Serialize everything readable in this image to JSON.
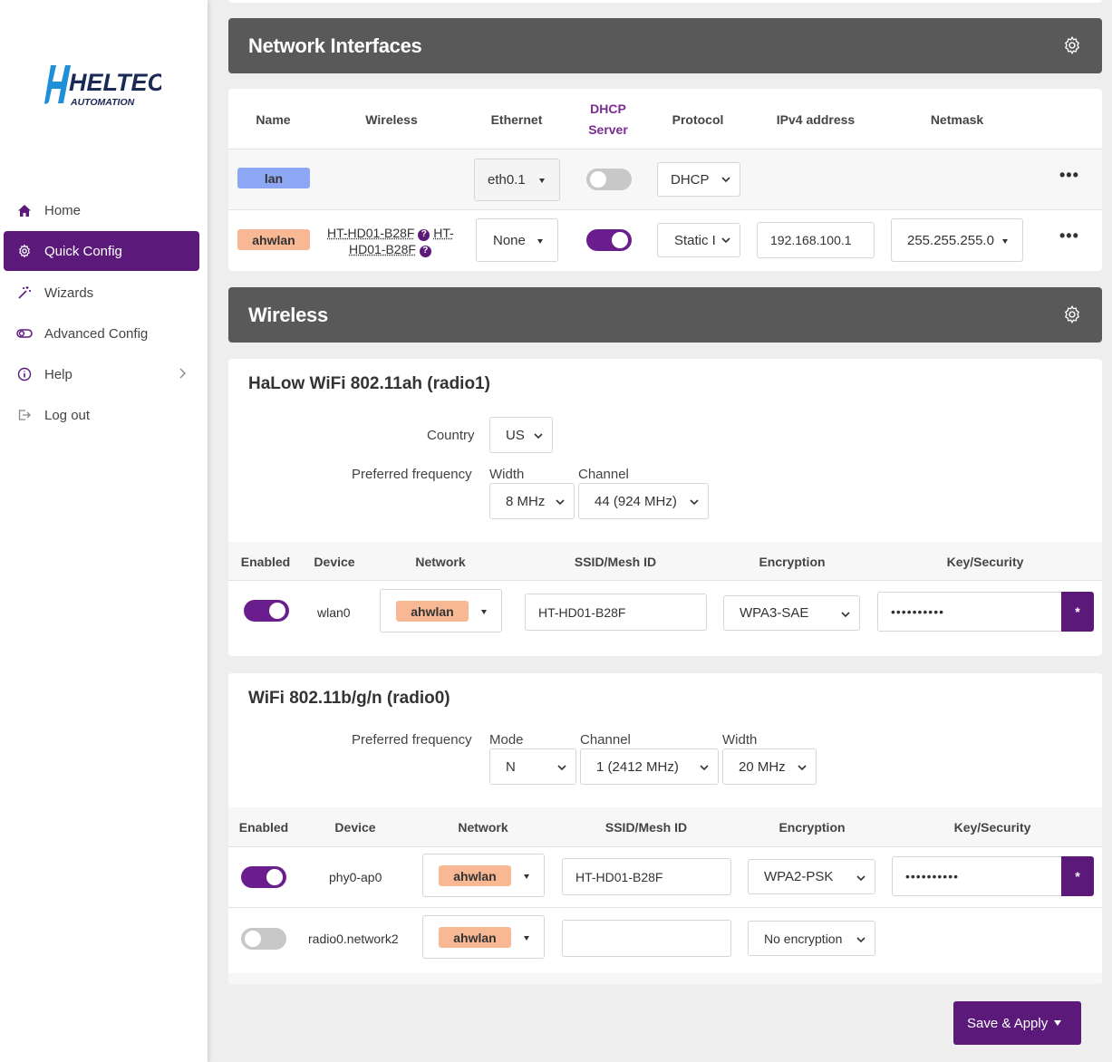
{
  "brand": {
    "logo_text": "HELTEC",
    "logo_sub": "AUTOMATION"
  },
  "sidebar": {
    "items": [
      {
        "label": "Home",
        "icon": "home-icon"
      },
      {
        "label": "Quick Config",
        "icon": "gear-icon"
      },
      {
        "label": "Wizards",
        "icon": "magic-wand-icon"
      },
      {
        "label": "Advanced Config",
        "icon": "toggle-icon"
      },
      {
        "label": "Help",
        "icon": "info-icon"
      },
      {
        "label": "Log out",
        "icon": "logout-icon"
      }
    ]
  },
  "network_interfaces": {
    "title": "Network Interfaces",
    "columns": {
      "name": "Name",
      "wireless": "Wireless",
      "ethernet": "Ethernet",
      "dhcp_line1": "DHCP",
      "dhcp_line2": "Server",
      "protocol": "Protocol",
      "ipv4": "IPv4 address",
      "netmask": "Netmask"
    },
    "rows": [
      {
        "name": "lan",
        "ethernet": "eth0.1",
        "dhcp_enabled": false,
        "protocol": "DHCP",
        "ipv4": "",
        "netmask": "",
        "more": "•••"
      },
      {
        "name": "ahwlan",
        "wireless_a1": "HT-HD01-B28F",
        "wireless_q": "?",
        "wireless_a2": "HT-",
        "wireless_a3": "HD01-B28F",
        "ethernet": "None",
        "dhcp_enabled": true,
        "protocol": "Static I",
        "ipv4": "192.168.100.1",
        "netmask": "255.255.255.0",
        "more": "•••"
      }
    ]
  },
  "wireless": {
    "title": "Wireless",
    "halow": {
      "title": "HaLow WiFi 802.11ah (radio1)",
      "country_label": "Country",
      "country": "US",
      "pref_label": "Preferred frequency",
      "width_label": "Width",
      "width": "8 MHz",
      "channel_label": "Channel",
      "channel": "44 (924 MHz)",
      "columns": {
        "enabled": "Enabled",
        "device": "Device",
        "network": "Network",
        "ssid": "SSID/Mesh ID",
        "encryption": "Encryption",
        "key": "Key/Security"
      },
      "rows": [
        {
          "enabled": true,
          "device": "wlan0",
          "network": "ahwlan",
          "ssid": "HT-HD01-B28F",
          "encryption": "WPA3-SAE",
          "key": "••••••••••",
          "reveal": "*"
        }
      ]
    },
    "wifi": {
      "title": "WiFi 802.11b/g/n (radio0)",
      "pref_label": "Preferred frequency",
      "mode_label": "Mode",
      "mode": "N",
      "channel_label": "Channel",
      "channel": "1 (2412 MHz)",
      "width_label": "Width",
      "width": "20 MHz",
      "columns": {
        "enabled": "Enabled",
        "device": "Device",
        "network": "Network",
        "ssid": "SSID/Mesh ID",
        "encryption": "Encryption",
        "key": "Key/Security"
      },
      "rows": [
        {
          "enabled": true,
          "device": "phy0-ap0",
          "network": "ahwlan",
          "ssid": "HT-HD01-B28F",
          "encryption": "WPA2-PSK",
          "key": "••••••••••",
          "reveal": "*"
        },
        {
          "enabled": false,
          "device": "radio0.network2",
          "network": "ahwlan",
          "ssid": "",
          "encryption": "No encryption"
        }
      ]
    }
  },
  "actions": {
    "save_apply": "Save & Apply"
  },
  "colors": {
    "accent": "#5b1a7a",
    "header_bg": "#595959",
    "lan_badge": "#8ea7f4",
    "ahwlan_badge": "#f7b893"
  }
}
